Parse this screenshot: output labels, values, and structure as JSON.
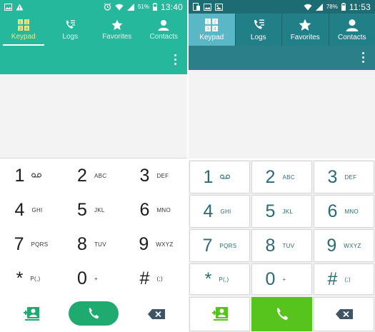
{
  "left": {
    "status": {
      "time": "13:40",
      "battery": "51%",
      "icons": [
        "gallery-icon",
        "warning-icon",
        "alarm-icon",
        "wifi-icon",
        "signal-icon",
        "battery-icon"
      ]
    },
    "tabs": [
      {
        "label": "Keypad",
        "icon": "keypad-icon",
        "selected": true
      },
      {
        "label": "Logs",
        "icon": "logs-icon",
        "selected": false
      },
      {
        "label": "Favorites",
        "icon": "star-icon",
        "selected": false
      },
      {
        "label": "Contacts",
        "icon": "contact-icon",
        "selected": false
      }
    ],
    "keys": [
      {
        "digit": "1",
        "sub": "",
        "icon": "voicemail-icon"
      },
      {
        "digit": "2",
        "sub": "ABC"
      },
      {
        "digit": "3",
        "sub": "DEF"
      },
      {
        "digit": "4",
        "sub": "GHI"
      },
      {
        "digit": "5",
        "sub": "JKL"
      },
      {
        "digit": "6",
        "sub": "MNO"
      },
      {
        "digit": "7",
        "sub": "PQRS"
      },
      {
        "digit": "8",
        "sub": "TUV"
      },
      {
        "digit": "9",
        "sub": "WXYZ"
      },
      {
        "digit": "*",
        "sub": "P(,)"
      },
      {
        "digit": "0",
        "sub": "+"
      },
      {
        "digit": "#",
        "sub": "(;)"
      }
    ],
    "colors": {
      "header": "#26b89c",
      "call": "#1faa70",
      "tab_selected_text": "#ffe07a"
    }
  },
  "right": {
    "status": {
      "time": "11:53",
      "battery": "78%",
      "icons": [
        "screenshot-icon",
        "gallery-icon",
        "image-icon",
        "wifi-icon",
        "signal-icon",
        "battery-icon"
      ]
    },
    "tabs": [
      {
        "label": "Keypad",
        "icon": "keypad-icon",
        "selected": true
      },
      {
        "label": "Logs",
        "icon": "logs-icon",
        "selected": false
      },
      {
        "label": "Favorites",
        "icon": "star-icon",
        "selected": false
      },
      {
        "label": "Contacts",
        "icon": "contact-icon",
        "selected": false
      }
    ],
    "keys": [
      {
        "digit": "1",
        "sub": "",
        "icon": "voicemail-icon"
      },
      {
        "digit": "2",
        "sub": "ABC"
      },
      {
        "digit": "3",
        "sub": "DEF"
      },
      {
        "digit": "4",
        "sub": "GHI"
      },
      {
        "digit": "5",
        "sub": "JKL"
      },
      {
        "digit": "6",
        "sub": "MNO"
      },
      {
        "digit": "7",
        "sub": "PQRS"
      },
      {
        "digit": "8",
        "sub": "TUV"
      },
      {
        "digit": "9",
        "sub": "WXYZ"
      },
      {
        "digit": "*",
        "sub": "P(,)"
      },
      {
        "digit": "0",
        "sub": "+"
      },
      {
        "digit": "#",
        "sub": "(;)"
      }
    ],
    "colors": {
      "header": "#217f88",
      "call": "#57c31d",
      "tab_selected_bg": "#5ab8c6"
    }
  }
}
